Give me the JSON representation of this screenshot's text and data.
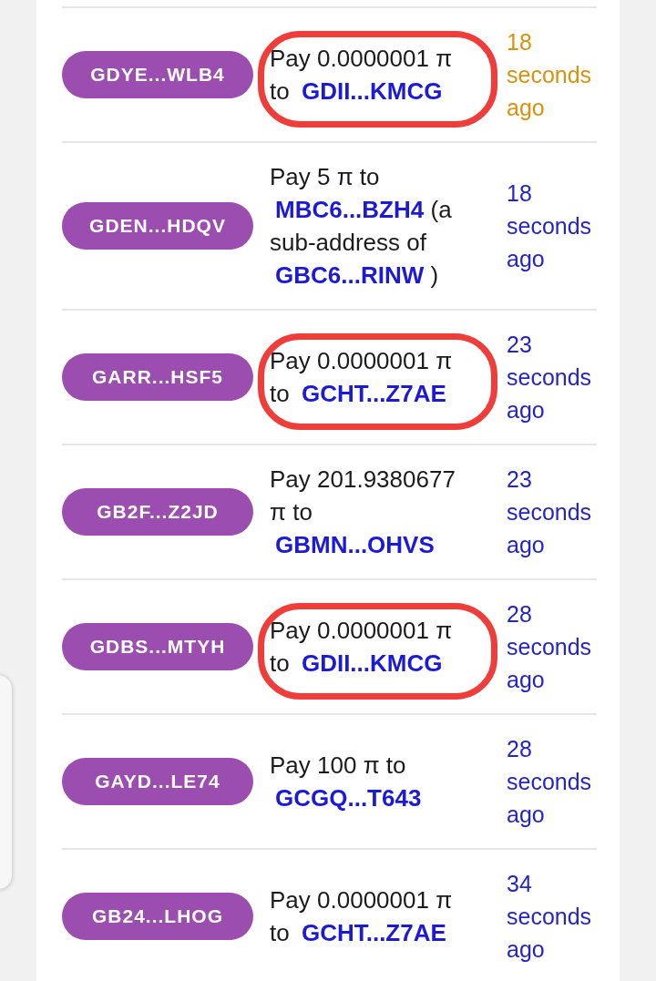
{
  "rows": [
    {
      "account": "GDYE...WLB4",
      "circled": true,
      "description": [
        {
          "kind": "text",
          "text": "Pay 0.0000001 π to"
        },
        {
          "kind": "link",
          "text": "GDII...KMCG"
        }
      ],
      "time": "18 seconds ago",
      "color": "#d8920e"
    },
    {
      "account": "GDEN...HDQV",
      "circled": false,
      "description": [
        {
          "kind": "text",
          "text": "Pay 5 π to"
        },
        {
          "kind": "link",
          "text": "MBC6...BZH4"
        },
        {
          "kind": "text",
          "text": "(a sub-address of"
        },
        {
          "kind": "link",
          "text": "GBC6...RINW"
        },
        {
          "kind": "text",
          "text": ")"
        }
      ],
      "time": "18 seconds ago",
      "color": "#2424cc"
    },
    {
      "account": "GARR...HSF5",
      "circled": true,
      "description": [
        {
          "kind": "text",
          "text": "Pay 0.0000001 π to"
        },
        {
          "kind": "link",
          "text": "GCHT...Z7AE"
        }
      ],
      "time": "23 seconds ago",
      "color": "#2424cc"
    },
    {
      "account": "GB2F...Z2JD",
      "circled": false,
      "description": [
        {
          "kind": "text",
          "text": "Pay 201.9380677 π to"
        },
        {
          "kind": "link",
          "text": "GBMN...OHVS"
        }
      ],
      "time": "23 seconds ago",
      "color": "#2424cc"
    },
    {
      "account": "GDBS...MTYH",
      "circled": true,
      "description": [
        {
          "kind": "text",
          "text": "Pay 0.0000001 π to"
        },
        {
          "kind": "link",
          "text": "GDII...KMCG"
        }
      ],
      "time": "28 seconds ago",
      "color": "#2424cc"
    },
    {
      "account": "GAYD...LE74",
      "circled": false,
      "description": [
        {
          "kind": "text",
          "text": "Pay 100 π to"
        },
        {
          "kind": "link",
          "text": "GCGQ...T643"
        }
      ],
      "time": "28 seconds ago",
      "color": "#2424cc"
    },
    {
      "account": "GB24...LHOG",
      "circled": false,
      "description": [
        {
          "kind": "text",
          "text": "Pay 0.0000001 π to"
        },
        {
          "kind": "link",
          "text": "GCHT...Z7AE"
        }
      ],
      "time": "34 seconds ago",
      "color": "#2424cc"
    }
  ]
}
